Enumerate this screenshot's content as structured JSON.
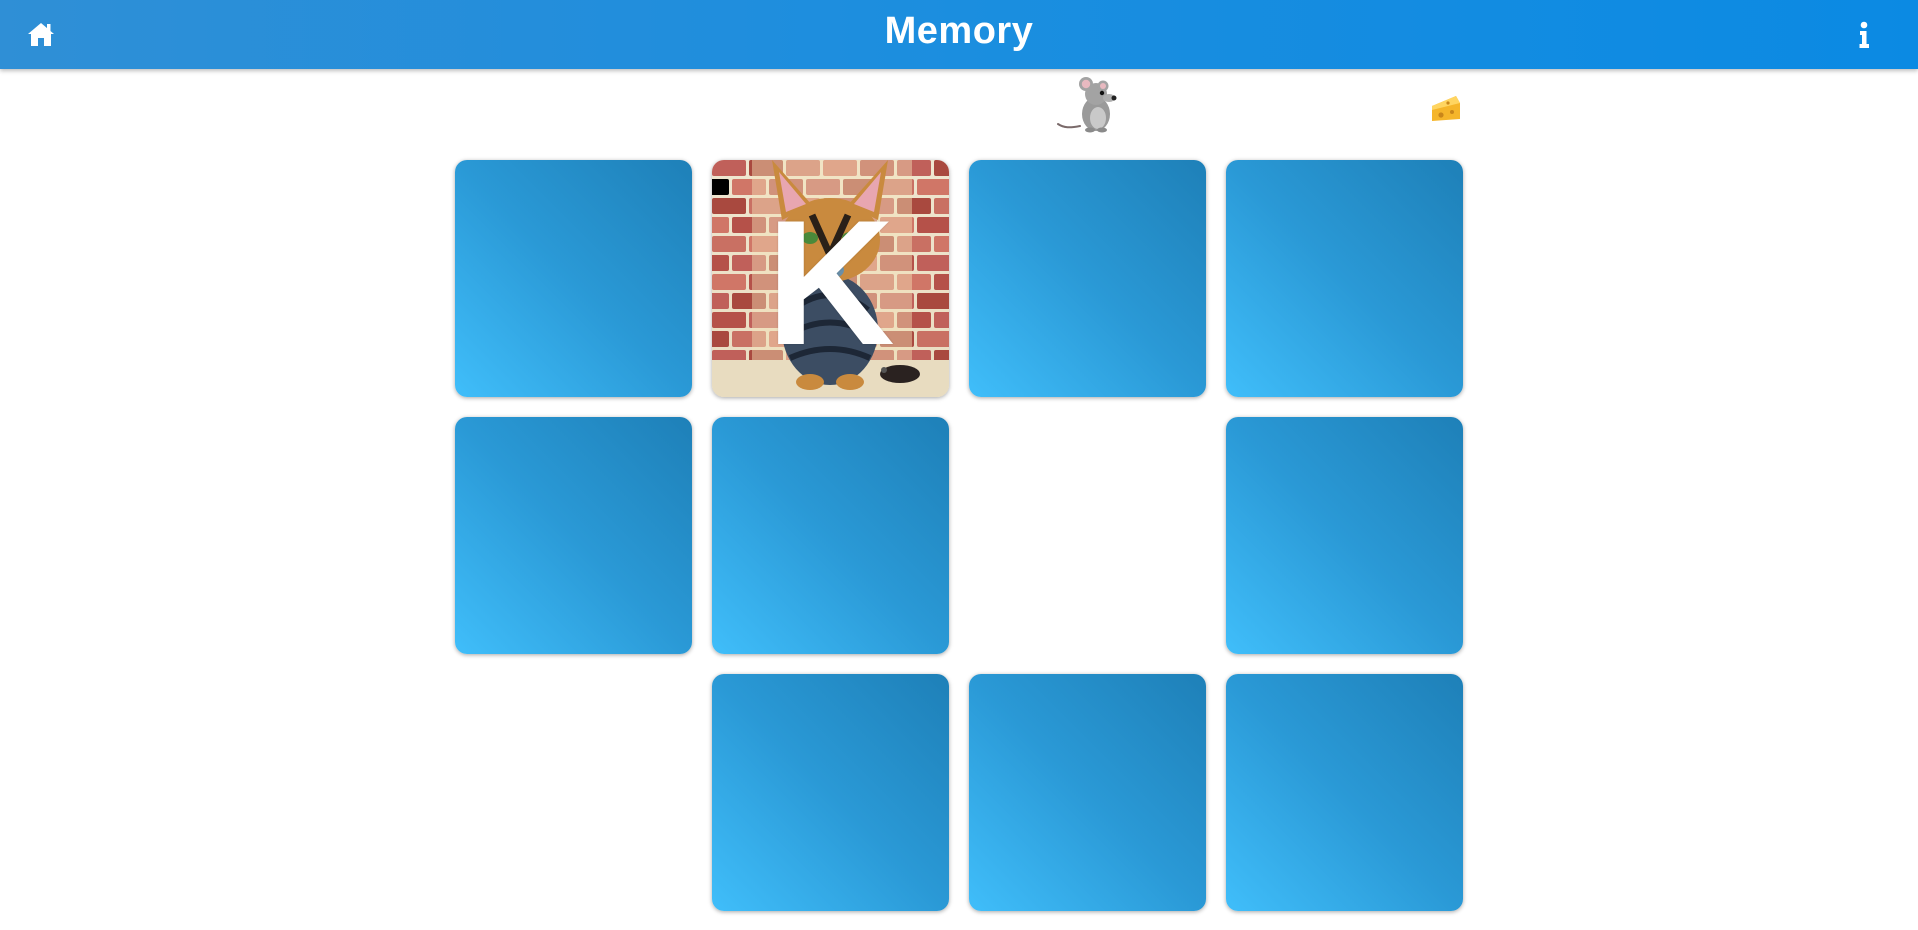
{
  "header": {
    "title": "Memory",
    "home_icon": "home-icon",
    "info_icon": "info-icon"
  },
  "progress": {
    "runner_icon": "mouse-icon",
    "goal_icon": "cheese-icon"
  },
  "colors": {
    "header": "#1b8edf",
    "card_back_dark": "#1e80b8",
    "card_back_light": "#40befa"
  },
  "board": {
    "rows": 3,
    "cols": 4,
    "cards": [
      {
        "state": "hidden",
        "letter": ""
      },
      {
        "state": "revealed",
        "letter": "K",
        "picture": "cat-on-brick-wall"
      },
      {
        "state": "hidden",
        "letter": ""
      },
      {
        "state": "hidden",
        "letter": ""
      },
      {
        "state": "hidden",
        "letter": ""
      },
      {
        "state": "hidden",
        "letter": ""
      },
      {
        "state": "matched",
        "letter": ""
      },
      {
        "state": "hidden",
        "letter": ""
      },
      {
        "state": "matched",
        "letter": ""
      },
      {
        "state": "hidden",
        "letter": ""
      },
      {
        "state": "hidden",
        "letter": ""
      },
      {
        "state": "hidden",
        "letter": ""
      }
    ]
  }
}
